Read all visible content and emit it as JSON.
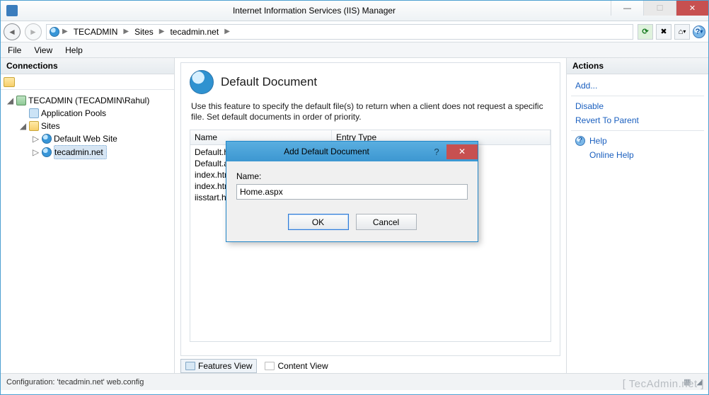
{
  "window": {
    "title": "Internet Information Services (IIS) Manager"
  },
  "breadcrumb": {
    "root": "TECADMIN",
    "level2": "Sites",
    "level3": "tecadmin.net"
  },
  "menubar": {
    "file": "File",
    "view": "View",
    "help": "Help"
  },
  "connections": {
    "title": "Connections",
    "server": "TECADMIN (TECADMIN\\Rahul)",
    "appPools": "Application Pools",
    "sites": "Sites",
    "site1": "Default Web Site",
    "site2": "tecadmin.net"
  },
  "page": {
    "title": "Default Document",
    "description": "Use this feature to specify the default file(s) to return when a client does not request a specific file. Set default documents in order of priority.",
    "col_name": "Name",
    "col_entry": "Entry Type",
    "rows": [
      "Default.htm",
      "Default.asp",
      "index.htm",
      "index.html",
      "iisstart.htm"
    ]
  },
  "tabs": {
    "features": "Features View",
    "content": "Content View"
  },
  "actions": {
    "title": "Actions",
    "add": "Add...",
    "disable": "Disable",
    "revert": "Revert To Parent",
    "help": "Help",
    "onlineHelp": "Online Help"
  },
  "dialog": {
    "title": "Add Default Document",
    "name_label": "Name:",
    "name_value": "Home.aspx",
    "ok": "OK",
    "cancel": "Cancel"
  },
  "statusbar": {
    "config": "Configuration: 'tecadmin.net' web.config"
  },
  "watermark": "[ TecAdmin.net ]"
}
